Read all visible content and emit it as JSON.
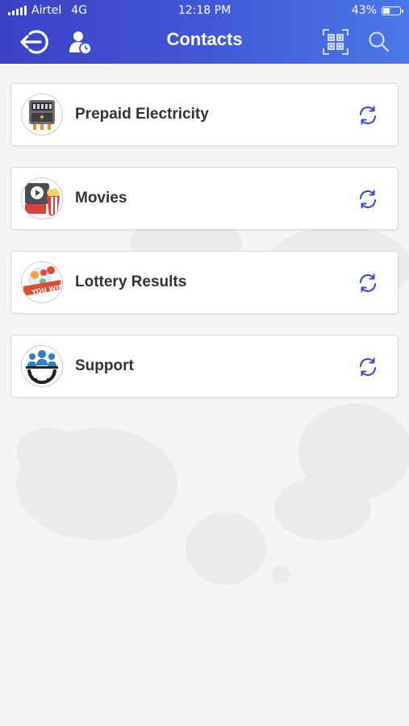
{
  "status_bar": {
    "carrier": "Airtel",
    "network": "4G",
    "time": "12:18 PM",
    "battery_percent": "43%",
    "battery_level": 0.43
  },
  "header": {
    "title": "Contacts",
    "icons": [
      "back-arrow-icon",
      "user-clock-icon",
      "qr-code-icon",
      "search-icon"
    ]
  },
  "colors": {
    "header_gradient_start": "#3b41c4",
    "header_gradient_end": "#4a78e8",
    "refresh_icon": "#3c48c8",
    "card_text": "#333333"
  },
  "contacts": [
    {
      "label": "Prepaid Electricity",
      "icon": "electricity-meter-icon"
    },
    {
      "label": "Movies",
      "icon": "movies-icon"
    },
    {
      "label": "Lottery Results",
      "icon": "lottery-icon"
    },
    {
      "label": "Support",
      "icon": "support-team-icon"
    }
  ]
}
